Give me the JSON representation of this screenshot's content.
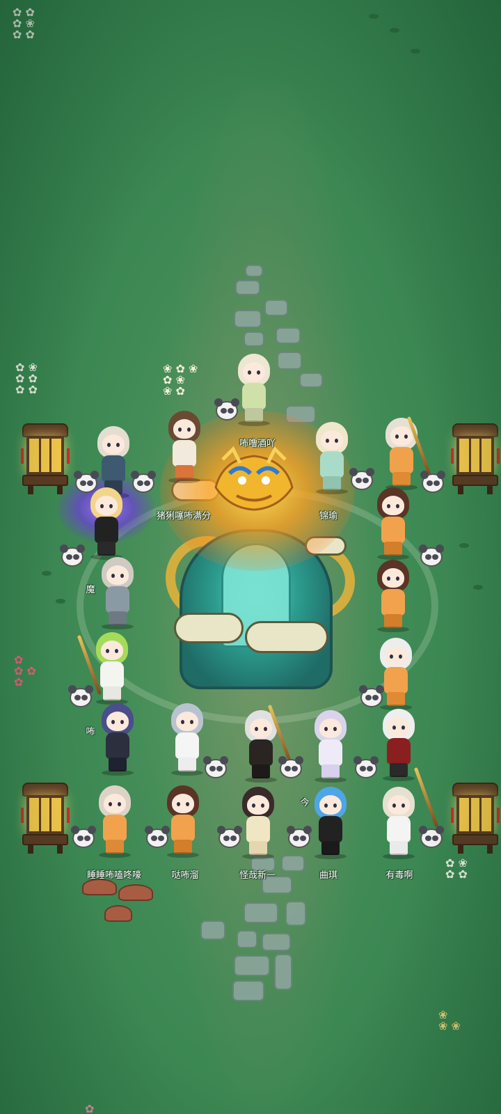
{
  "scene": {
    "type": "game-lobby",
    "background_color": "#3f8a55",
    "centerpiece": "dragon-throne-icon",
    "player_names": [
      "咘噜酒吖",
      "猪猁噻咘满分",
      "锦瑜",
      "魔",
      "咘",
      "今",
      "睡睡咘嗑咚嚎",
      "哒咘溜",
      "怪哉新一",
      "曲琪",
      "有毒啊"
    ]
  },
  "colors": {
    "grass": "#3f8a55",
    "throne": "#2c9c8e",
    "dragon_gold": "#e9b33a",
    "aura_purple": "#8a5cff",
    "lantern_gold": "#f1c64a"
  }
}
